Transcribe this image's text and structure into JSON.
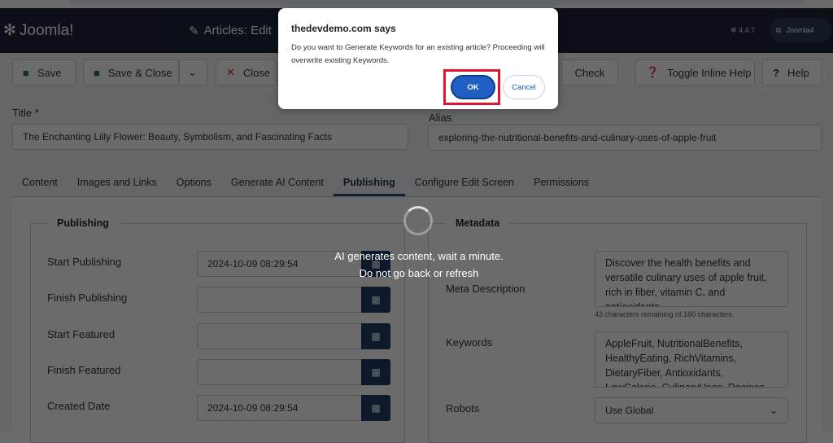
{
  "header": {
    "logo": "Joomla!",
    "page_title": "Articles: Edit",
    "version": "4.4.7",
    "user_button": "Joomla4"
  },
  "toolbar": {
    "save": "Save",
    "save_close": "Save & Close",
    "close": "Close",
    "check": "Check",
    "toggle_help": "Toggle Inline Help",
    "help": "Help"
  },
  "form": {
    "title_label": "Title *",
    "title_value": "The Enchanting Lilly Flower: Beauty, Symbolism, and Fascinating Facts",
    "alias_label": "Alias",
    "alias_value": "exploring-the-nutritional-benefits-and-culinary-uses-of-apple-fruit"
  },
  "tabs": [
    "Content",
    "Images and Links",
    "Options",
    "Generate AI Content",
    "Publishing",
    "Configure Edit Screen",
    "Permissions"
  ],
  "active_tab": "Publishing",
  "publishing": {
    "legend": "Publishing",
    "fields": [
      {
        "label": "Start Publishing",
        "value": "2024-10-09 08:29:54"
      },
      {
        "label": "Finish Publishing",
        "value": ""
      },
      {
        "label": "Start Featured",
        "value": ""
      },
      {
        "label": "Finish Featured",
        "value": ""
      },
      {
        "label": "Created Date",
        "value": "2024-10-09 08:29:54"
      }
    ]
  },
  "metadata": {
    "legend": "Metadata",
    "meta_desc_label": "Meta Description",
    "meta_desc_value": " Discover the health benefits and versatile culinary uses of apple fruit, rich in fiber, vitamin C, and antioxidants.",
    "meta_desc_hint": "43 characters remaining of 160 characters.",
    "keywords_label": "Keywords",
    "keywords_value": "AppleFruit, NutritionalBenefits, HealthyEating, RichVitamins, DietaryFiber, Antioxidants, LowCalorie, CulinaryUses, Recipes",
    "robots_label": "Robots",
    "robots_value": "Use Global"
  },
  "loading": {
    "line1": "AI generates content, wait a minute.",
    "line2": "Do not go back or refresh"
  },
  "dialog": {
    "title": "thedevdemo.com says",
    "message": "Do you want to Generate Keywords for an existing article? Proceeding will overwrite existing Keywords.",
    "ok": "OK",
    "cancel": "Cancel"
  },
  "colors": {
    "header": "#1c2439",
    "ok_button": "#1f5fc4",
    "highlight": "#e0142b"
  }
}
